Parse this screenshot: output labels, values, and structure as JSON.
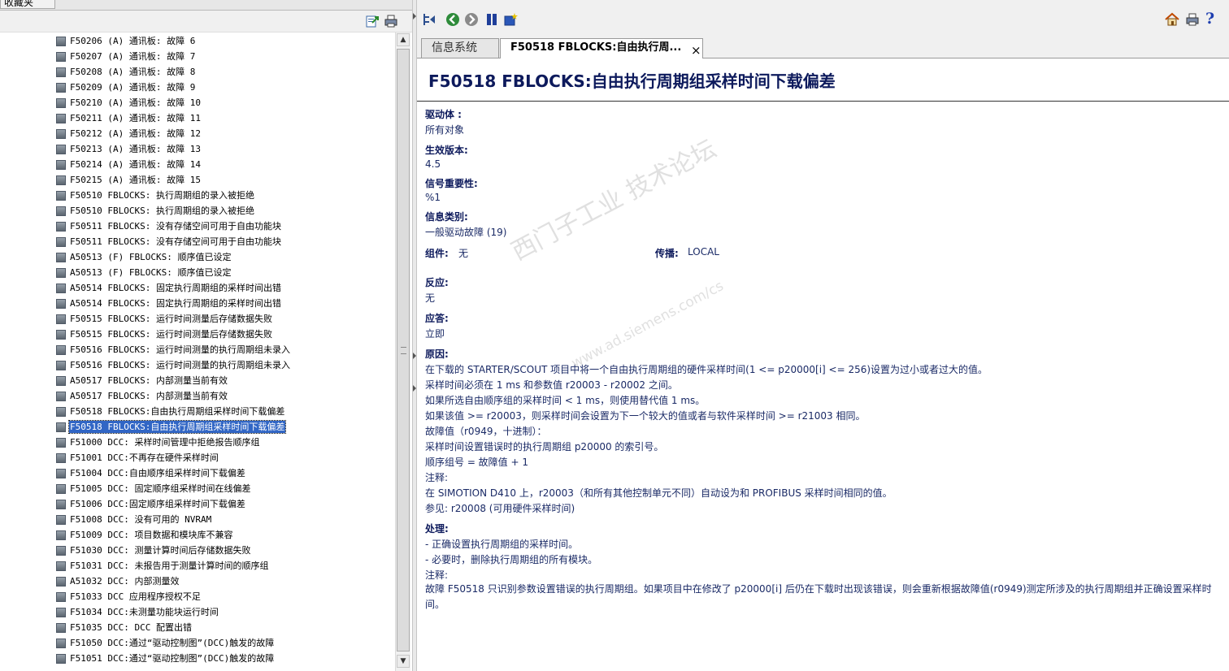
{
  "left_pane": {
    "tab_label": "收藏夹",
    "toolbar": {
      "export_icon": "export-icon",
      "print_icon": "print-icon"
    },
    "tree_items": [
      {
        "label": "F50206 (A) 通讯板: 故障 6"
      },
      {
        "label": "F50207 (A) 通讯板: 故障 7"
      },
      {
        "label": "F50208 (A) 通讯板: 故障 8"
      },
      {
        "label": "F50209 (A) 通讯板: 故障 9"
      },
      {
        "label": "F50210 (A) 通讯板: 故障 10"
      },
      {
        "label": "F50211 (A) 通讯板: 故障 11"
      },
      {
        "label": "F50212 (A) 通讯板: 故障 12"
      },
      {
        "label": "F50213 (A) 通讯板: 故障 13"
      },
      {
        "label": "F50214 (A) 通讯板: 故障 14"
      },
      {
        "label": "F50215 (A) 通讯板: 故障 15"
      },
      {
        "label": "F50510 FBLOCKS: 执行周期组的录入被拒绝"
      },
      {
        "label": "F50510 FBLOCKS: 执行周期组的录入被拒绝"
      },
      {
        "label": "F50511 FBLOCKS: 没有存储空间可用于自由功能块"
      },
      {
        "label": "F50511 FBLOCKS: 没有存储空间可用于自由功能块"
      },
      {
        "label": "A50513 (F) FBLOCKS: 顺序值已设定"
      },
      {
        "label": "A50513 (F) FBLOCKS: 顺序值已设定"
      },
      {
        "label": "A50514 FBLOCKS: 固定执行周期组的采样时间出错"
      },
      {
        "label": "A50514 FBLOCKS: 固定执行周期组的采样时间出错"
      },
      {
        "label": "F50515 FBLOCKS: 运行时间测量后存储数据失败"
      },
      {
        "label": "F50515 FBLOCKS: 运行时间测量后存储数据失败"
      },
      {
        "label": "F50516 FBLOCKS: 运行时间测量的执行周期组未录入"
      },
      {
        "label": "F50516 FBLOCKS: 运行时间测量的执行周期组未录入"
      },
      {
        "label": "A50517 FBLOCKS: 内部测量当前有效"
      },
      {
        "label": "A50517 FBLOCKS: 内部测量当前有效"
      },
      {
        "label": "F50518 FBLOCKS:自由执行周期组采样时间下载偏差"
      },
      {
        "label": "F50518 FBLOCKS:自由执行周期组采样时间下载偏差",
        "selected": true
      },
      {
        "label": "F51000 DCC: 采样时间管理中拒绝报告顺序组"
      },
      {
        "label": "F51001 DCC:不再存在硬件采样时间"
      },
      {
        "label": "F51004 DCC:自由顺序组采样时间下载偏差"
      },
      {
        "label": "F51005 DCC: 固定顺序组采样时间在线偏差"
      },
      {
        "label": "F51006 DCC:固定顺序组采样时间下载偏差"
      },
      {
        "label": "F51008 DCC: 没有可用的 NVRAM"
      },
      {
        "label": "F51009 DCC: 项目数据和模块库不兼容"
      },
      {
        "label": "F51030 DCC: 测量计算时间后存储数据失败"
      },
      {
        "label": "F51031 DCC: 未报告用于测量计算时间的顺序组"
      },
      {
        "label": "A51032 DCC: 内部测量效"
      },
      {
        "label": "F51033 DCC 应用程序授权不足"
      },
      {
        "label": "F51034 DCC:未测量功能块运行时间"
      },
      {
        "label": "F51035 DCC: DCC 配置出错"
      },
      {
        "label": "F51050 DCC:通过“驱动控制图”(DCC)触发的故障"
      },
      {
        "label": "F51051 DCC:通过“驱动控制图”(DCC)触发的故障"
      }
    ]
  },
  "right_pane": {
    "toolbar": {
      "left_icons": [
        "tree-sync-icon",
        "back-icon",
        "forward-icon",
        "bookmark-icon",
        "add-favorite-icon"
      ],
      "right_icons": [
        "home-icon",
        "print-icon",
        "help-icon"
      ],
      "help_glyph": "?"
    },
    "tabs": [
      {
        "label": "信息系统"
      },
      {
        "label": "F50518 FBLOCKS:自由执行周...",
        "close": "×"
      }
    ],
    "page_title": "F50518 FBLOCKS:自由执行周期组采样时间下载偏差",
    "fields": {
      "drive_object_label": "驱动体 :",
      "drive_object_value": "所有对象",
      "valid_version_label": "生效版本:",
      "valid_version_value": "4.5",
      "signal_importance_label": "信号重要性:",
      "signal_importance_value": "%1",
      "message_class_label": "信息类别:",
      "message_class_value": "一般驱动故障 (19)",
      "component_label": "组件:",
      "component_value": "无",
      "propagation_label": "传播:",
      "propagation_value": "LOCAL",
      "reaction_label": "反应:",
      "reaction_value": "无",
      "acknowledge_label": "应答:",
      "acknowledge_value": "立即",
      "cause_label": "原因:",
      "cause_lines": [
        "在下载的 STARTER/SCOUT 项目中将一个自由执行周期组的硬件采样时间(1 <= p20000[i] <= 256)设置为过小或者过大的值。",
        "采样时间必须在 1 ms 和参数值 r20003 - r20002 之间。",
        "如果所选自由顺序组的采样时间 < 1 ms，则使用替代值 1 ms。",
        "如果该值 >= r20003，则采样时间会设置为下一个较大的值或者与软件采样时间 >= r21003 相同。",
        "故障值（r0949，十进制）：",
        "采样时间设置错误时的执行周期组 p20000 的索引号。",
        "顺序组号 = 故障值 + 1",
        "注释:",
        "在 SIMOTION D410 上，r20003（和所有其他控制单元不同）自动设为和 PROFIBUS 采样时间相同的值。",
        "参见:  r20008 (可用硬件采样时间)"
      ],
      "remedy_label": "处理:",
      "remedy_lines": [
        "- 正确设置执行周期组的采样时间。",
        "- 必要时，删除执行周期组的所有模块。",
        "注释:"
      ],
      "remedy_note": "故障 F50518 只识别参数设置错误的执行周期组。如果项目中在修改了 p20000[i] 后仍在下载时出现该错误，则会重新根据故障值(r0949)测定所涉及的执行周期组并正确设置采样时间。"
    },
    "watermark": {
      "text_cn": "西门子工业 技术论坛",
      "text_url": "www.ad.siemens.com/cs"
    }
  },
  "colors": {
    "selection": "#3166c5",
    "title_text": "#0d1a5c",
    "body_text": "#1a2a66"
  }
}
